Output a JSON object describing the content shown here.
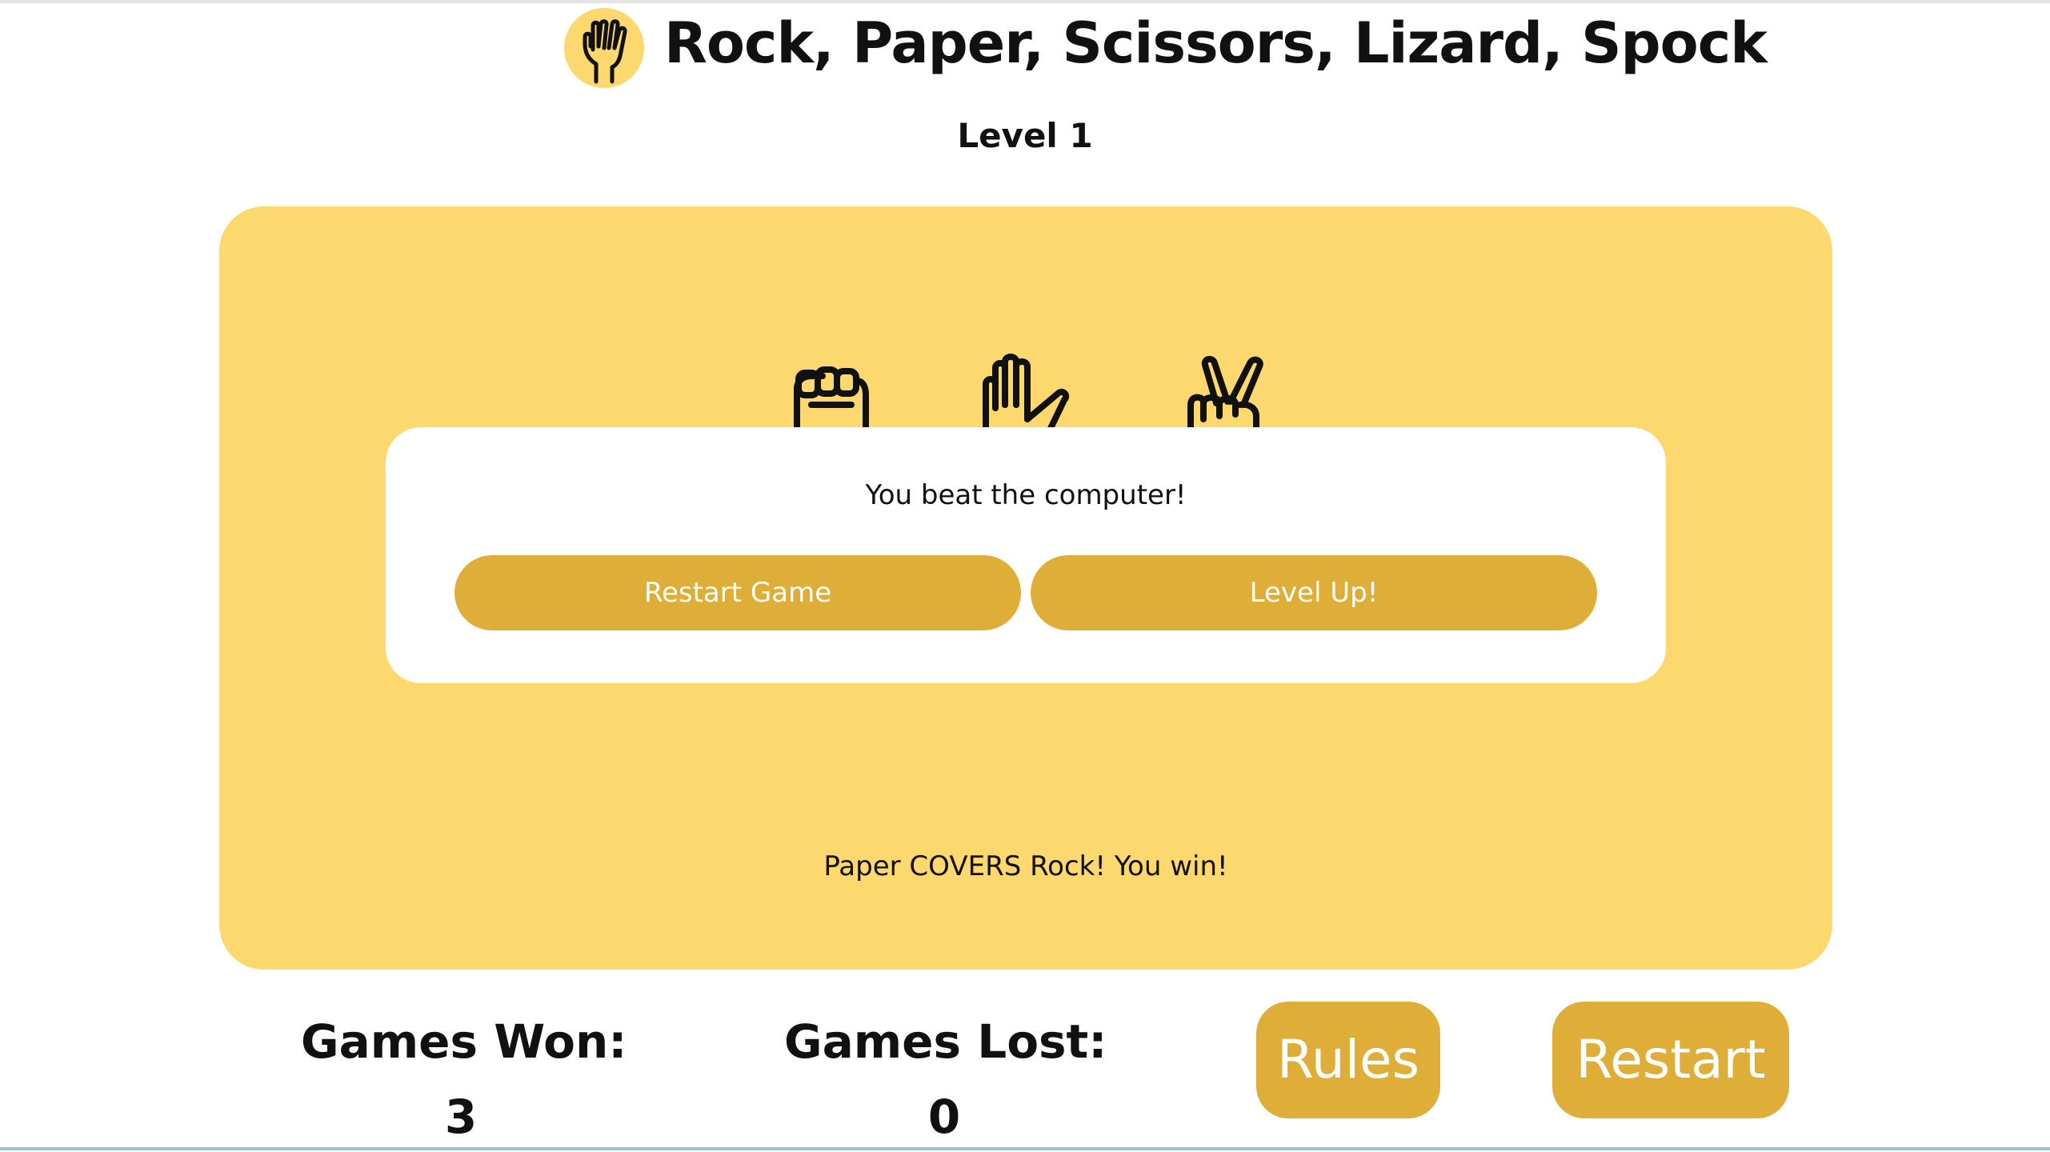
{
  "header": {
    "title": "Rock, Paper, Scissors, Lizard, Spock",
    "logo_icon": "vulcan-salute-hand-icon"
  },
  "level_text": "Level 1",
  "board": {
    "choices": [
      {
        "name": "rock",
        "icon": "fist-icon"
      },
      {
        "name": "paper",
        "icon": "open-hand-icon"
      },
      {
        "name": "scissors",
        "icon": "victory-hand-icon"
      }
    ],
    "result_text": "Paper COVERS Rock! You win!"
  },
  "modal": {
    "message": "You beat the computer!",
    "restart_game_label": "Restart Game",
    "level_up_label": "Level Up!"
  },
  "stats": {
    "won_label": "Games Won:",
    "won_value": "3",
    "lost_label": "Games Lost:",
    "lost_value": "0"
  },
  "controls": {
    "rules_label": "Rules",
    "restart_label": "Restart"
  },
  "colors": {
    "board": "#fcd86f",
    "button": "#dfae39",
    "modal": "#ffffff"
  }
}
